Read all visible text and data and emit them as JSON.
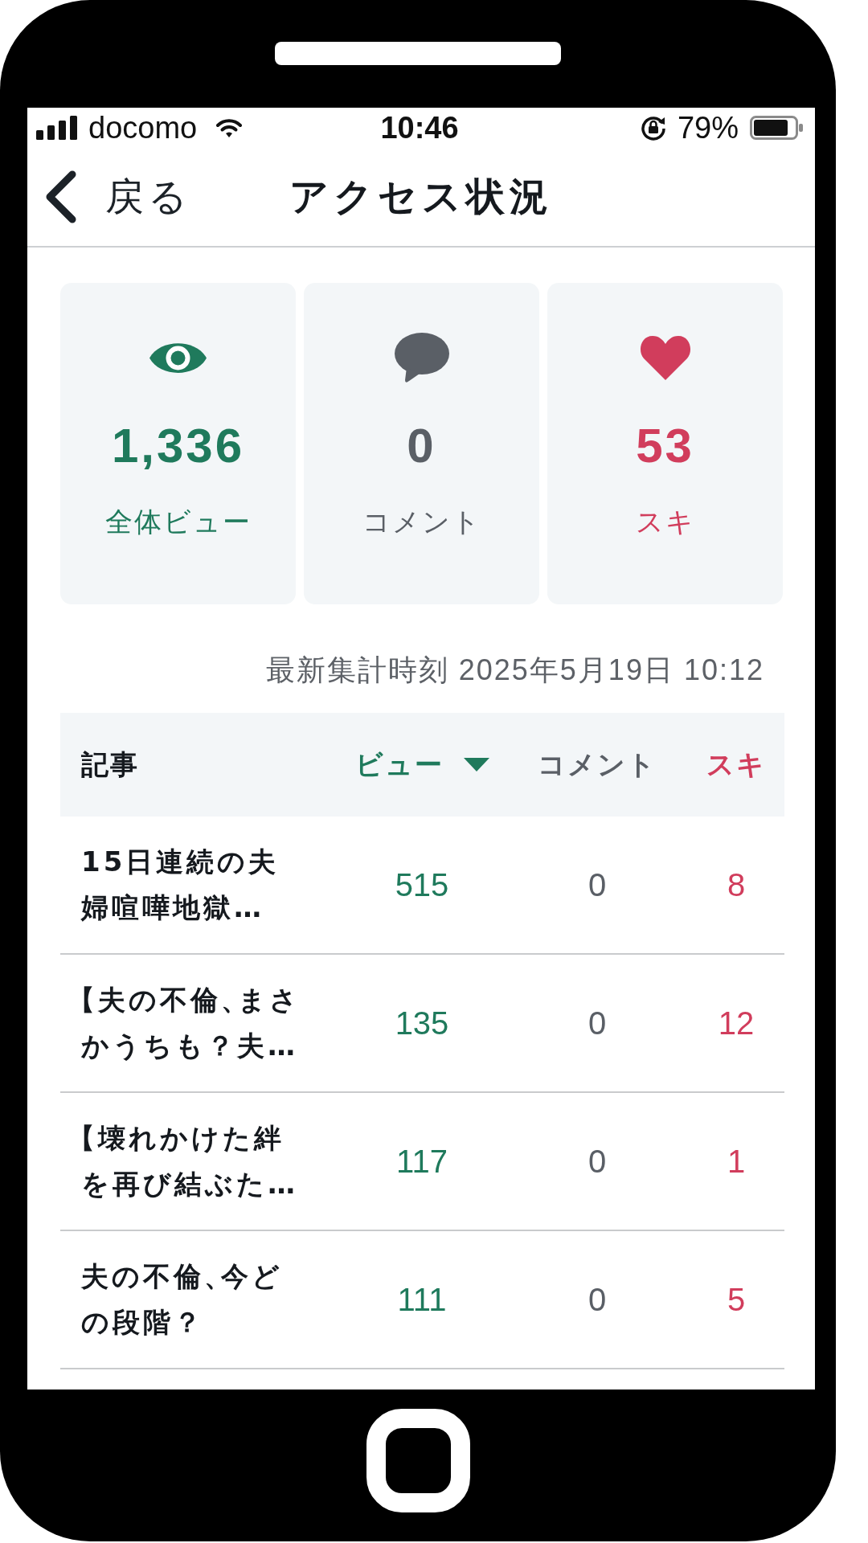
{
  "status_bar": {
    "carrier": "docomo",
    "time": "10:46",
    "battery": "79%"
  },
  "header": {
    "back_label": "戻る",
    "title": "アクセス状況"
  },
  "stats": [
    {
      "kind": "views",
      "value": "1,336",
      "label": "全体ビュー",
      "color": "#1f7a5c"
    },
    {
      "kind": "comments",
      "value": "0",
      "label": "コメント",
      "color": "#5a5f66"
    },
    {
      "kind": "likes",
      "value": "53",
      "label": "スキ",
      "color": "#d13d5c"
    }
  ],
  "updated_at": "最新集計時刻 2025年5月19日 10:12",
  "table": {
    "columns": [
      {
        "label": "記事",
        "sorted": false,
        "color": "#15191e"
      },
      {
        "label": "ビュー",
        "sorted": true,
        "color": "#1f7a5c"
      },
      {
        "label": "コメント",
        "sorted": false,
        "color": "#5a5f66"
      },
      {
        "label": "スキ",
        "sorted": false,
        "color": "#d13d5c"
      }
    ],
    "rows": [
      {
        "cells": [
          "15日連続の夫婦喧嘩地獄…",
          "515",
          "0",
          "8"
        ]
      },
      {
        "cells": [
          "【夫の不倫、まさかうちも？夫…",
          "135",
          "0",
          "12"
        ]
      },
      {
        "cells": [
          "【壊れかけた絆を再び結ぶた…",
          "117",
          "0",
          "1"
        ]
      },
      {
        "cells": [
          "夫の不倫、今どの段階？",
          "111",
          "0",
          "5"
        ]
      }
    ]
  }
}
